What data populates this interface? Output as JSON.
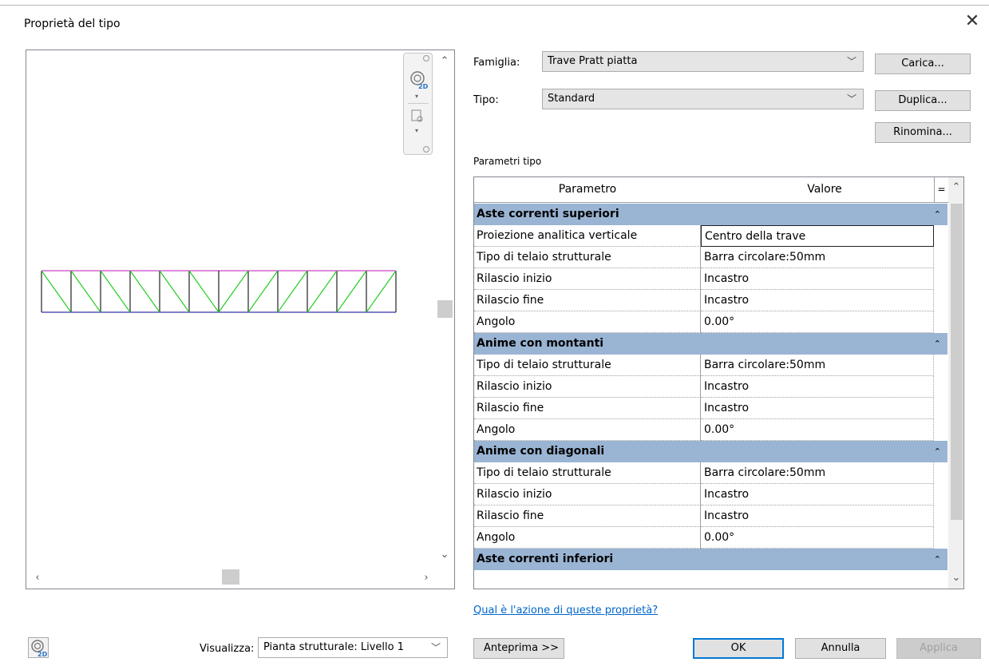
{
  "window": {
    "title": "Proprietà del tipo",
    "close_icon": "close-icon"
  },
  "form": {
    "famiglia_label": "Famiglia:",
    "famiglia_value": "Trave Pratt piatta",
    "tipo_label": "Tipo:",
    "tipo_value": "Standard",
    "carica": "Carica...",
    "duplica": "Duplica...",
    "rinomina": "Rinomina...",
    "parametri_label": "Parametri tipo"
  },
  "table": {
    "headers": {
      "parametro": "Parametro",
      "valore": "Valore",
      "eq": "="
    },
    "groups": [
      {
        "name": "Aste correnti superiori",
        "rows": [
          {
            "p": "Proiezione analitica verticale",
            "v": "Centro della trave"
          },
          {
            "p": "Tipo di telaio strutturale",
            "v": "Barra circolare:50mm"
          },
          {
            "p": "Rilascio inizio",
            "v": "Incastro"
          },
          {
            "p": "Rilascio fine",
            "v": "Incastro"
          },
          {
            "p": "Angolo",
            "v": "0.00°"
          }
        ]
      },
      {
        "name": "Anime con montanti",
        "rows": [
          {
            "p": "Tipo di telaio strutturale",
            "v": "Barra circolare:50mm"
          },
          {
            "p": "Rilascio inizio",
            "v": "Incastro"
          },
          {
            "p": "Rilascio fine",
            "v": "Incastro"
          },
          {
            "p": "Angolo",
            "v": "0.00°"
          }
        ]
      },
      {
        "name": "Anime con diagonali",
        "rows": [
          {
            "p": "Tipo di telaio strutturale",
            "v": "Barra circolare:50mm"
          },
          {
            "p": "Rilascio inizio",
            "v": "Incastro"
          },
          {
            "p": "Rilascio fine",
            "v": "Incastro"
          },
          {
            "p": "Angolo",
            "v": "0.00°"
          }
        ]
      },
      {
        "name": "Aste correnti inferiori",
        "rows": []
      }
    ]
  },
  "link": "Qual è l'azione di queste proprietà?",
  "footer": {
    "visualizza_label": "Visualizza:",
    "visualizza_value": "Pianta strutturale: Livello 1",
    "anteprima": "Anteprima >>",
    "ok": "OK",
    "annulla": "Annulla",
    "applica": "Applica"
  },
  "colors": {
    "group_header": "#9ab4d3",
    "truss_chord": "#cc44cc",
    "truss_diag": "#22cc22",
    "link": "#0066cc",
    "ok_border": "#0078d7"
  }
}
